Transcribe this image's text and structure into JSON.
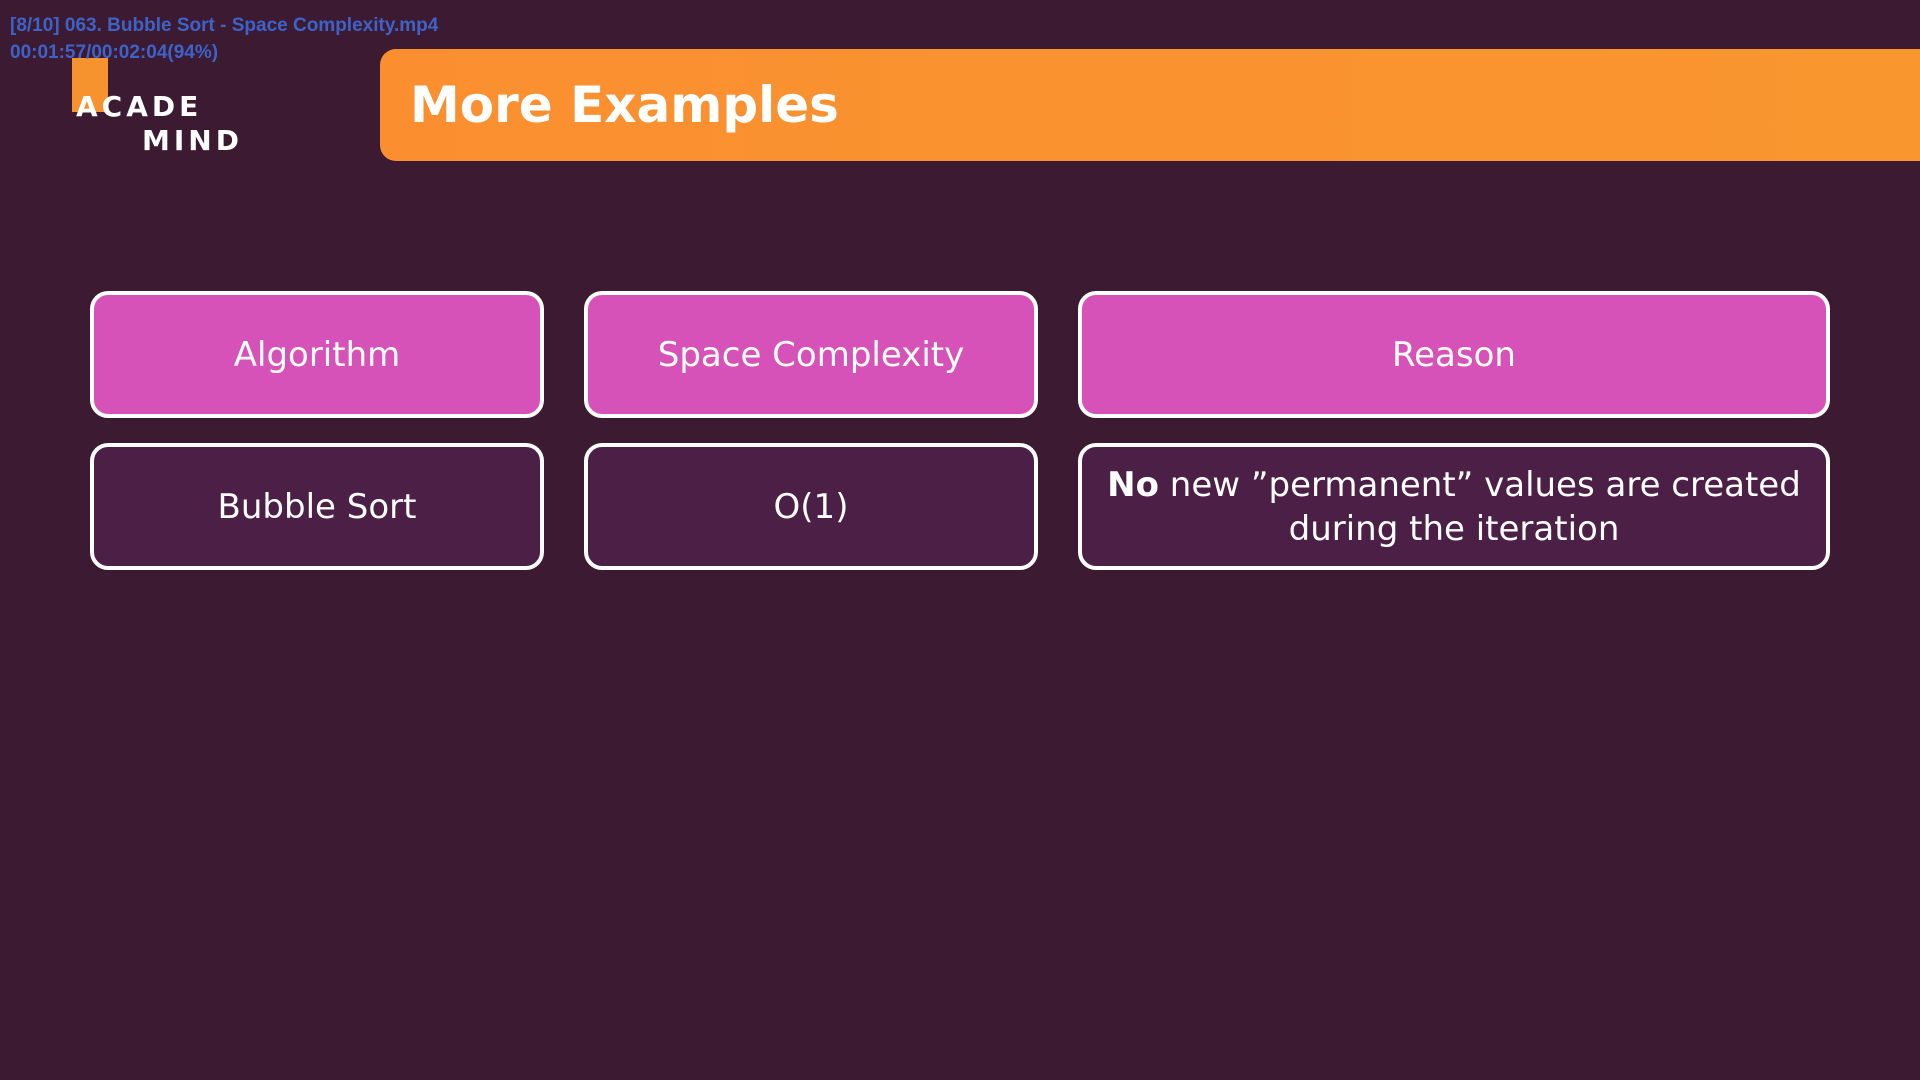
{
  "player": {
    "filename": "[8/10] 063. Bubble Sort - Space Complexity.mp4",
    "timecode": "00:01:57/00:02:04(94%)"
  },
  "logo": {
    "line1": "ACADE",
    "line2": "MIND"
  },
  "slide": {
    "title": "More Examples"
  },
  "table": {
    "headers": [
      "Algorithm",
      "Space Complexity",
      "Reason"
    ],
    "rows": [
      {
        "algorithm": "Bubble Sort",
        "space_complexity": "O(1)",
        "reason_bold": "No",
        "reason_rest": " new ”permanent” values are created during the iteration"
      }
    ]
  },
  "colors": {
    "background": "#3b1a32",
    "banner": "#fb8f30",
    "header_cell": "#d752b8",
    "body_cell": "#4c1f46",
    "border": "#ffffff",
    "overlay_text": "#3d63c9"
  }
}
